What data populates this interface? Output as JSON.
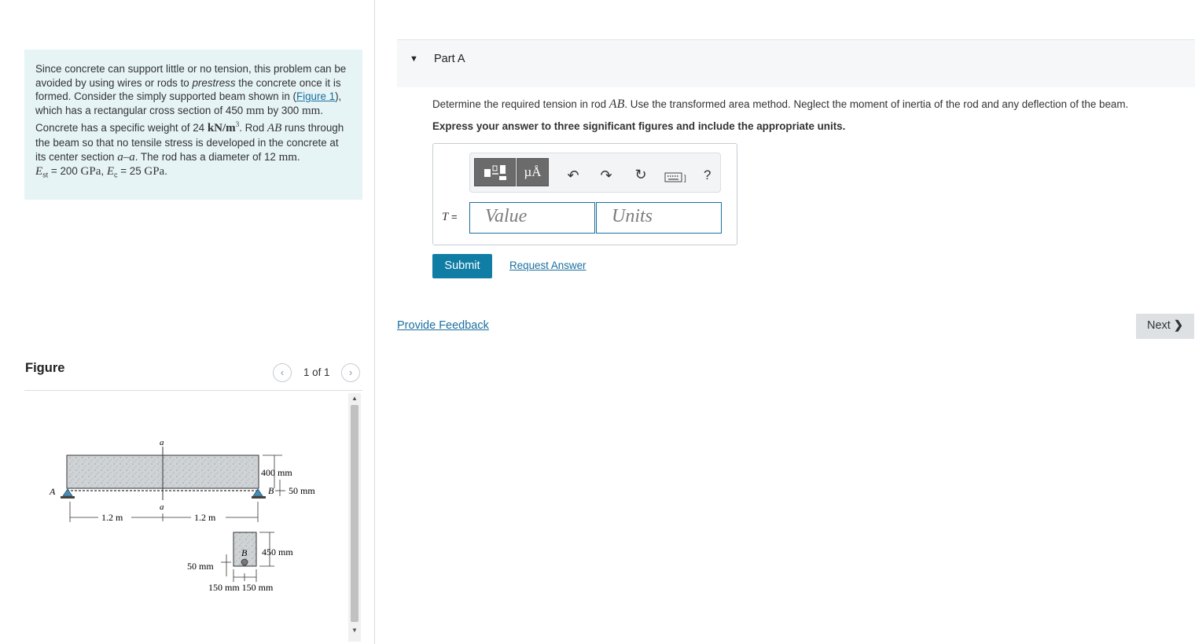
{
  "problem": {
    "t1": "Since concrete can support little or no tension, this problem can be avoided by using wires or rods to ",
    "t1_em": "prestress",
    "t2": " the concrete once it is formed. Consider the simply supported beam shown in (",
    "figure_link": "Figure 1",
    "t3": "), which has a rectangular cross section of 450 ",
    "u_mm1": "mm",
    "t4": " by 300 ",
    "u_mm2": "mm",
    "t5": ". Concrete has a specific weight of 24 ",
    "u_kn": "kN/m",
    "u_kn_sup": "3",
    "t6": ". Rod ",
    "rod_ab": "AB",
    "t7": " runs through the beam so that no tensile stress is developed in the concrete at its center section ",
    "section_aa": "a–a",
    "t8": ". The rod has a diameter of 12 ",
    "u_mm3": "mm",
    "t9": ".",
    "e_st_sym": "E",
    "e_st_sub": "st",
    "e_st_val": " = 200 ",
    "e_st_unit": "GPa",
    "comma": ", ",
    "e_c_sym": "E",
    "e_c_sub": "c",
    "e_c_val": " = 25 ",
    "e_c_unit": "GPa",
    "end": "."
  },
  "figure": {
    "title": "Figure",
    "pager_text": "1 of 1",
    "labels": {
      "a_top": "a",
      "a_bottom": "a",
      "A": "A",
      "B": "B",
      "dim_400": "400 mm",
      "dim_50_side": "50 mm",
      "dim_1_2_left": "1.2 m",
      "dim_1_2_right": "1.2 m",
      "cs_B": "B",
      "dim_450": "450 mm",
      "dim_50_bottom": "50 mm",
      "dim_150_150": "150 mm  150 mm"
    }
  },
  "part_a": {
    "title": "Part A",
    "q1": "Determine the required tension in rod ",
    "q_ab": "AB",
    "q2": ". Use the transformed area method. Neglect the moment of inertia of the rod and any deflection of the beam.",
    "instruction": "Express your answer to three significant figures and include the appropriate units.",
    "toolbar": {
      "micro_label": "µÅ",
      "help_label": "?"
    },
    "answer_var": "T",
    "answer_eq": " =",
    "value_placeholder": "Value",
    "units_placeholder": "Units",
    "submit_label": "Submit",
    "request_answer_label": "Request Answer"
  },
  "footer": {
    "feedback_label": "Provide Feedback",
    "next_label": "Next"
  },
  "colors": {
    "problem_bg": "#e6f4f6",
    "link": "#1a6f9f",
    "submit_bg": "#107da5",
    "next_bg": "#dee1e4"
  }
}
